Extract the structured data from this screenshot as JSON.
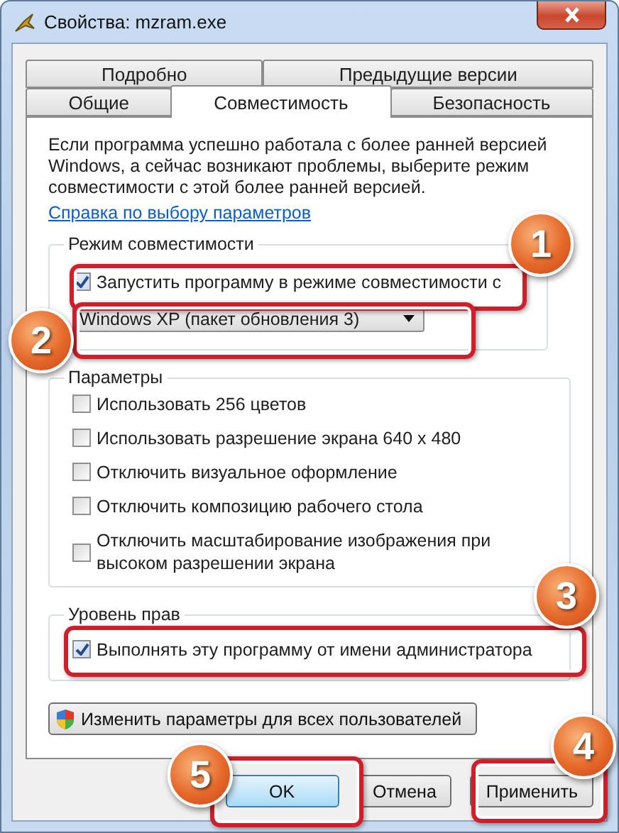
{
  "window": {
    "title": "Свойства: mzram.exe"
  },
  "tab_rows": [
    {
      "tabs": [
        {
          "label": "Подробно",
          "selected": false
        },
        {
          "label": "Предыдущие версии",
          "selected": false
        }
      ]
    },
    {
      "tabs": [
        {
          "label": "Общие",
          "selected": false
        },
        {
          "label": "Совместимость",
          "selected": true
        },
        {
          "label": "Безопасность",
          "selected": false
        }
      ]
    }
  ],
  "description": "Если программа успешно работала с более ранней версией Windows, а сейчас возникают проблемы, выберите режим совместимости с этой более ранней версией.",
  "help_link": "Справка по выбору параметров",
  "compatibility_mode": {
    "title": "Режим совместимости",
    "checkbox": {
      "label": "Запустить программу в режиме совместимости с",
      "checked": true
    },
    "dropdown": {
      "value": "Windows XP (пакет обновления 3)"
    }
  },
  "settings": {
    "title": "Параметры",
    "options": [
      {
        "label": "Использовать 256 цветов",
        "checked": false
      },
      {
        "label": "Использовать разрешение экрана 640 x 480",
        "checked": false
      },
      {
        "label": "Отключить визуальное оформление",
        "checked": false
      },
      {
        "label": "Отключить композицию рабочего стола",
        "checked": false
      },
      {
        "label": "Отключить масштабирование изображения при высоком разрешении экрана",
        "checked": false
      }
    ]
  },
  "privilege_level": {
    "title": "Уровень прав",
    "options": [
      {
        "label": "Выполнять эту программу от имени администратора",
        "checked": true
      }
    ]
  },
  "all_users_button": "Изменить параметры для всех пользователей",
  "buttons": [
    {
      "label": "OK",
      "kind": "default"
    },
    {
      "label": "Отмена",
      "kind": "normal"
    },
    {
      "label": "Применить",
      "kind": "normal"
    }
  ],
  "callouts": [
    {
      "label": "1"
    },
    {
      "label": "2"
    },
    {
      "label": "3"
    },
    {
      "label": "4"
    },
    {
      "label": "5"
    }
  ]
}
